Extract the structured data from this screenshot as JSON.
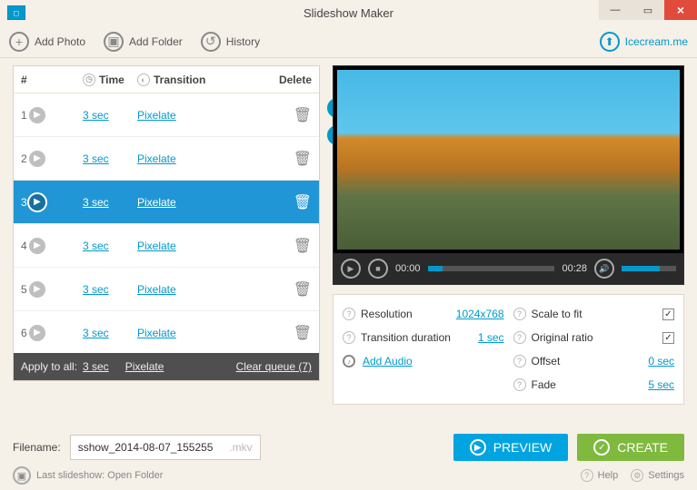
{
  "title": "Slideshow Maker",
  "toolbar": {
    "add_photo": "Add Photo",
    "add_folder": "Add Folder",
    "history": "History",
    "brand": "Icecream.me"
  },
  "table": {
    "head_num": "#",
    "head_time": "Time",
    "head_transition": "Transition",
    "head_delete": "Delete",
    "rows": [
      {
        "num": "1",
        "time": "3 sec",
        "transition": "Pixelate",
        "selected": false
      },
      {
        "num": "2",
        "time": "3 sec",
        "transition": "Pixelate",
        "selected": false
      },
      {
        "num": "3",
        "time": "3 sec",
        "transition": "Pixelate",
        "selected": true
      },
      {
        "num": "4",
        "time": "3 sec",
        "transition": "Pixelate",
        "selected": false
      },
      {
        "num": "5",
        "time": "3 sec",
        "transition": "Pixelate",
        "selected": false
      },
      {
        "num": "6",
        "time": "3 sec",
        "transition": "Pixelate",
        "selected": false
      }
    ],
    "apply_label": "Apply to all:",
    "apply_time": "3 sec",
    "apply_transition": "Pixelate",
    "clear_queue": "Clear queue (7)"
  },
  "player": {
    "current": "00:00",
    "total": "00:28"
  },
  "settings": {
    "resolution_label": "Resolution",
    "resolution_value": "1024x768",
    "scale_label": "Scale to fit",
    "transition_label": "Transition duration",
    "transition_value": "1 sec",
    "ratio_label": "Original ratio",
    "add_audio": "Add Audio",
    "offset_label": "Offset",
    "offset_value": "0 sec",
    "fade_label": "Fade",
    "fade_value": "5 sec"
  },
  "bottom": {
    "filename_label": "Filename:",
    "filename_value": "sshow_2014-08-07_155255",
    "filename_ext": ".mkv",
    "preview": "PREVIEW",
    "create": "CREATE"
  },
  "footer": {
    "last": "Last slideshow: Open Folder",
    "help": "Help",
    "settings": "Settings"
  }
}
